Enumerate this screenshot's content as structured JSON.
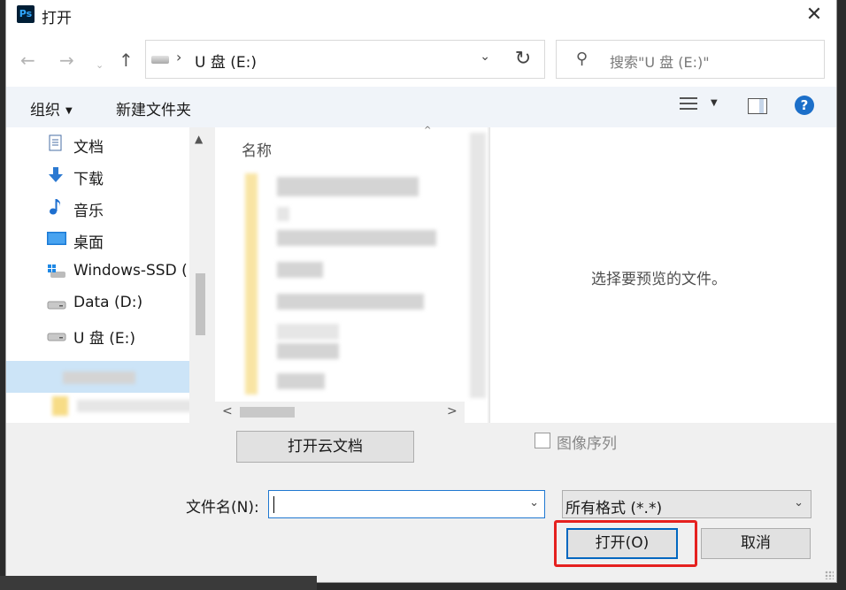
{
  "dialog": {
    "title": "打开",
    "app_icon": "Ps"
  },
  "nav": {
    "back_icon": "arrow-left-icon",
    "forward_icon": "arrow-right-icon",
    "up_icon": "arrow-up-icon",
    "address": "U 盘 (E:)",
    "search_placeholder": "搜索\"U 盘 (E:)\""
  },
  "toolbar": {
    "organize": "组织",
    "new_folder": "新建文件夹"
  },
  "sidebar": {
    "items": [
      {
        "label": "文档",
        "icon": "document-icon"
      },
      {
        "label": "下载",
        "icon": "download-icon"
      },
      {
        "label": "音乐",
        "icon": "music-icon"
      },
      {
        "label": "桌面",
        "icon": "desktop-icon"
      },
      {
        "label": "Windows-SSD (",
        "icon": "drive-icon"
      },
      {
        "label": "Data (D:)",
        "icon": "drive-icon"
      },
      {
        "label": "U 盘 (E:)",
        "icon": "drive-icon"
      }
    ]
  },
  "filelist": {
    "column_name": "名称"
  },
  "preview": {
    "message": "选择要预览的文件。"
  },
  "bottom": {
    "cloud_button": "打开云文档",
    "image_sequence_label": "图像序列",
    "filename_label": "文件名(N):",
    "filename_value": "",
    "filter_value": "所有格式 (*.*)",
    "open_button": "打开(O)",
    "cancel_button": "取消"
  },
  "colors": {
    "accent": "#0067c0",
    "highlight": "#e5211f",
    "selection": "#cce4f7"
  }
}
